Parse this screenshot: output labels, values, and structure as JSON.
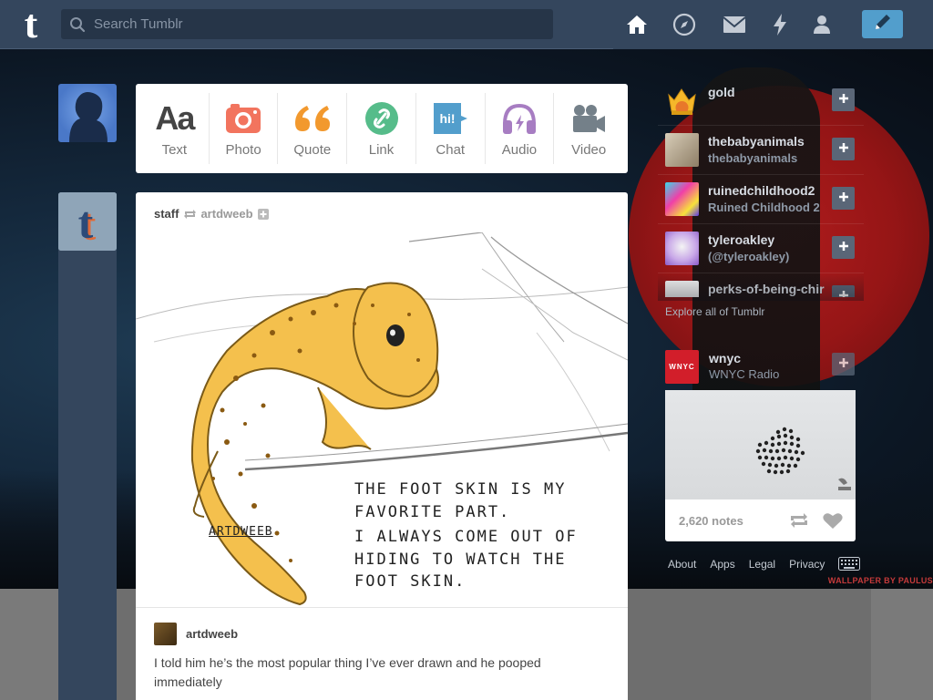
{
  "header": {
    "logo": "t",
    "search_placeholder": "Search Tumblr",
    "nav": [
      "home-icon",
      "explore-icon",
      "inbox-icon",
      "activity-icon",
      "account-icon"
    ],
    "compose_icon": "pencil-icon"
  },
  "post_types": [
    {
      "label": "Text",
      "icon": "text-icon",
      "color": "#444444"
    },
    {
      "label": "Photo",
      "icon": "camera-icon",
      "color": "#f2745e"
    },
    {
      "label": "Quote",
      "icon": "quote-icon",
      "color": "#f2992e"
    },
    {
      "label": "Link",
      "icon": "link-icon",
      "color": "#56bc8a"
    },
    {
      "label": "Chat",
      "icon": "chat-icon",
      "color": "#529ecc"
    },
    {
      "label": "Audio",
      "icon": "headphones-icon",
      "color": "#a77dc2"
    },
    {
      "label": "Video",
      "icon": "video-camera-icon",
      "color": "#748089"
    }
  ],
  "post": {
    "author": "staff",
    "reblogged_from": "artdweeb",
    "art_text_1": "THE FOOT SKIN IS MY\nFAVORITE PART.",
    "art_text_2": "I ALWAYS COME OUT OF\nHIDING TO WATCH THE\nFOOT SKIN.",
    "art_signature": "ARTDWEEB",
    "reblog_author": "artdweeb",
    "caption": "I told him he’s the most popular thing I’ve ever drawn and he pooped immediately"
  },
  "recommended": [
    {
      "name": "gold",
      "sub": ""
    },
    {
      "name": "thebabyanimals",
      "sub": "thebabyanimals"
    },
    {
      "name": "ruinedchildhood2",
      "sub": "Ruined Childhood 2"
    },
    {
      "name": "tyleroakley",
      "sub": "(@tyleroakley)"
    },
    {
      "name": "perks-of-being-chir",
      "sub": ""
    }
  ],
  "explore_link": "Explore all of Tumblr",
  "radar": {
    "name": "wnyc",
    "sub": "WNYC Radio",
    "avatar_text": "WNYC",
    "notes": "2,620 notes"
  },
  "footer": [
    "About",
    "Apps",
    "Legal",
    "Privacy"
  ],
  "wallpaper_credit": "WALLPAPER BY PAULUS"
}
